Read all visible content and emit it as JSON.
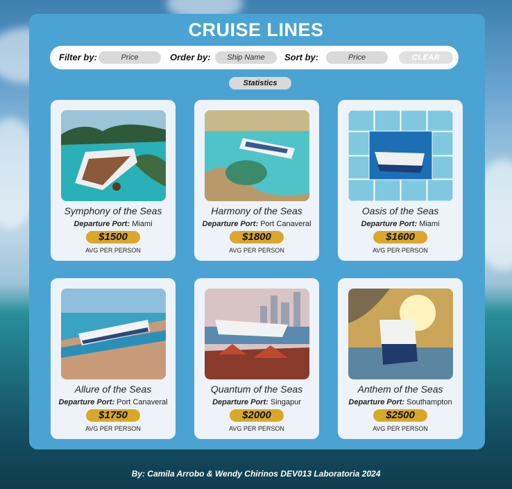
{
  "header": {
    "title": "CRUISE LINES"
  },
  "toolbar": {
    "filter_label": "Filter by:",
    "filter_value": "Price",
    "order_label": "Order by:",
    "order_value": "Ship Name",
    "sort_label": "Sort by:",
    "sort_value": "Price",
    "clear_label": "CLEAR"
  },
  "statistics_label": "Statistics",
  "cards": [
    {
      "name": "Symphony of the Seas",
      "port_label": "Departure Port:",
      "port": "Miami",
      "price": "$1500",
      "avg": "AVG PER PERSON"
    },
    {
      "name": "Harmony of the Seas",
      "port_label": "Departure Port:",
      "port": "Port Canaveral",
      "price": "$1800",
      "avg": "AVG PER PERSON"
    },
    {
      "name": "Oasis of the Seas",
      "port_label": "Departure Port:",
      "port": "Miami",
      "price": "$1600",
      "avg": "AVG PER PERSON"
    },
    {
      "name": "Allure of the Seas",
      "port_label": "Departure Port:",
      "port": "Port Canaveral",
      "price": "$1750",
      "avg": "AVG PER PERSON"
    },
    {
      "name": "Quantum of the Seas",
      "port_label": "Departure Port:",
      "port": "Singapur",
      "price": "$2000",
      "avg": "AVG PER PERSON"
    },
    {
      "name": "Anthem of the Seas",
      "port_label": "Departure Port:",
      "port": "Southampton",
      "price": "$2500",
      "avg": "AVG PER PERSON"
    }
  ],
  "footer": {
    "credits": "By: Camila Arrobo & Wendy Chirinos DEV013 Laboratoria 2024"
  },
  "colors": {
    "panel": "#4aa3d3",
    "price_badge": "#d9a82b",
    "card": "#edf3f8"
  }
}
